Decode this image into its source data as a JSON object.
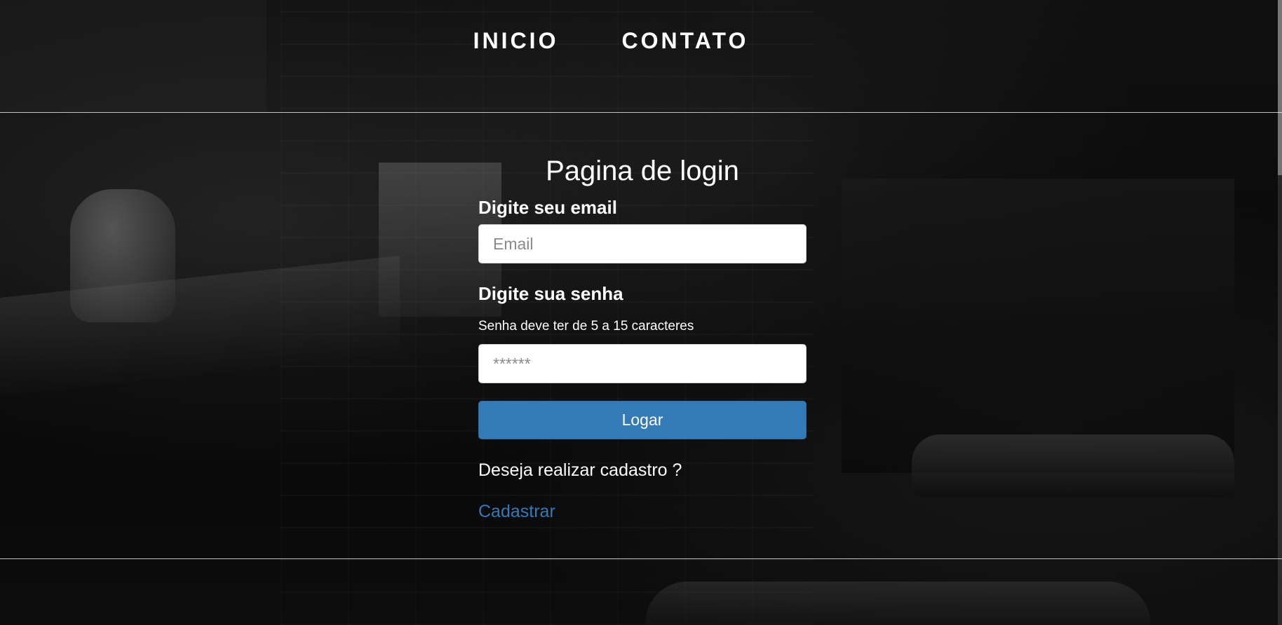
{
  "nav": {
    "items": [
      {
        "label": "INICIO"
      },
      {
        "label": "CONTATO"
      }
    ]
  },
  "login": {
    "title": "Pagina de login",
    "email_label": "Digite seu email",
    "email_placeholder": "Email",
    "password_label": "Digite sua senha",
    "password_hint": "Senha deve ter de 5 a 15 caracteres",
    "password_placeholder": "******",
    "submit_label": "Logar",
    "signup_prompt": "Deseja realizar cadastro ?",
    "signup_link": "Cadastrar"
  },
  "colors": {
    "primary": "#337ab7",
    "text": "#ffffff"
  }
}
